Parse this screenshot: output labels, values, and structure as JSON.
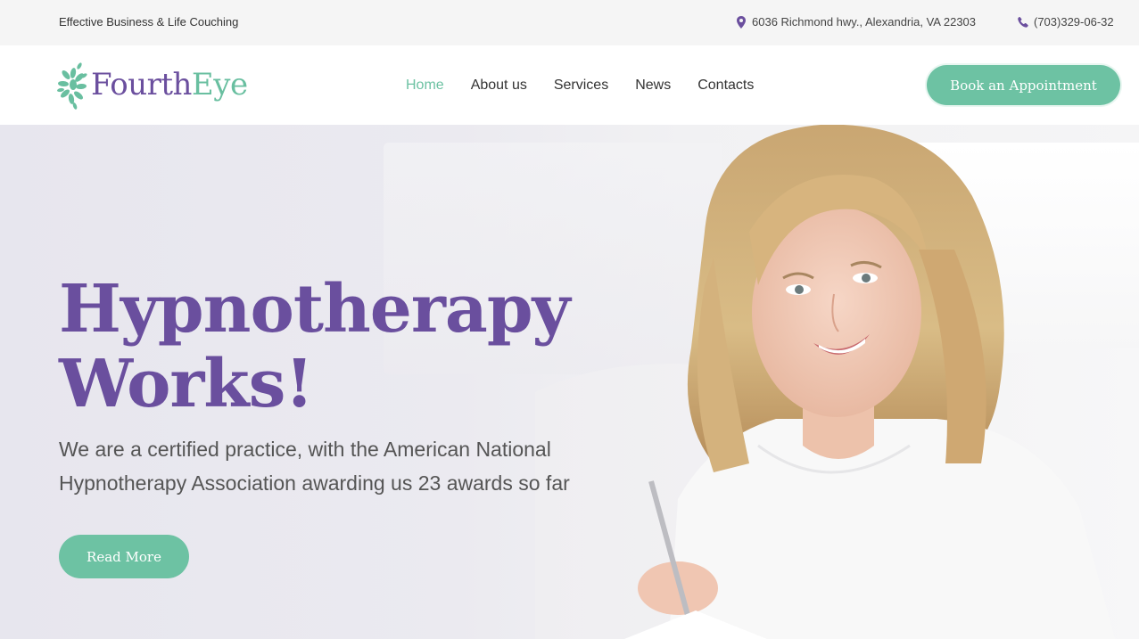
{
  "topbar": {
    "tagline": "Effective Business & Life Couching",
    "address": "6036 Richmond hwy., Alexandria, VA 22303",
    "address_icon": "map-pin-icon",
    "phone": "(703)329-06-32",
    "phone_icon": "phone-icon"
  },
  "header": {
    "logo_part1": "Fourth",
    "logo_part2": "Eye",
    "nav": [
      {
        "label": "Home",
        "active": true
      },
      {
        "label": "About us"
      },
      {
        "label": "Services"
      },
      {
        "label": "News"
      },
      {
        "label": "Contacts"
      }
    ],
    "cta_label": "Book an Appointment"
  },
  "hero": {
    "title_line1": "Hypnotherapy",
    "title_line2": "Works!",
    "subtitle_line1": "We are a certified practice, with the American National",
    "subtitle_line2": "Hypnotherapy Association awarding us 23 awards so far",
    "button_label": "Read More"
  },
  "colors": {
    "brand_purple": "#6a4f9e",
    "brand_green": "#6dc2a3"
  }
}
